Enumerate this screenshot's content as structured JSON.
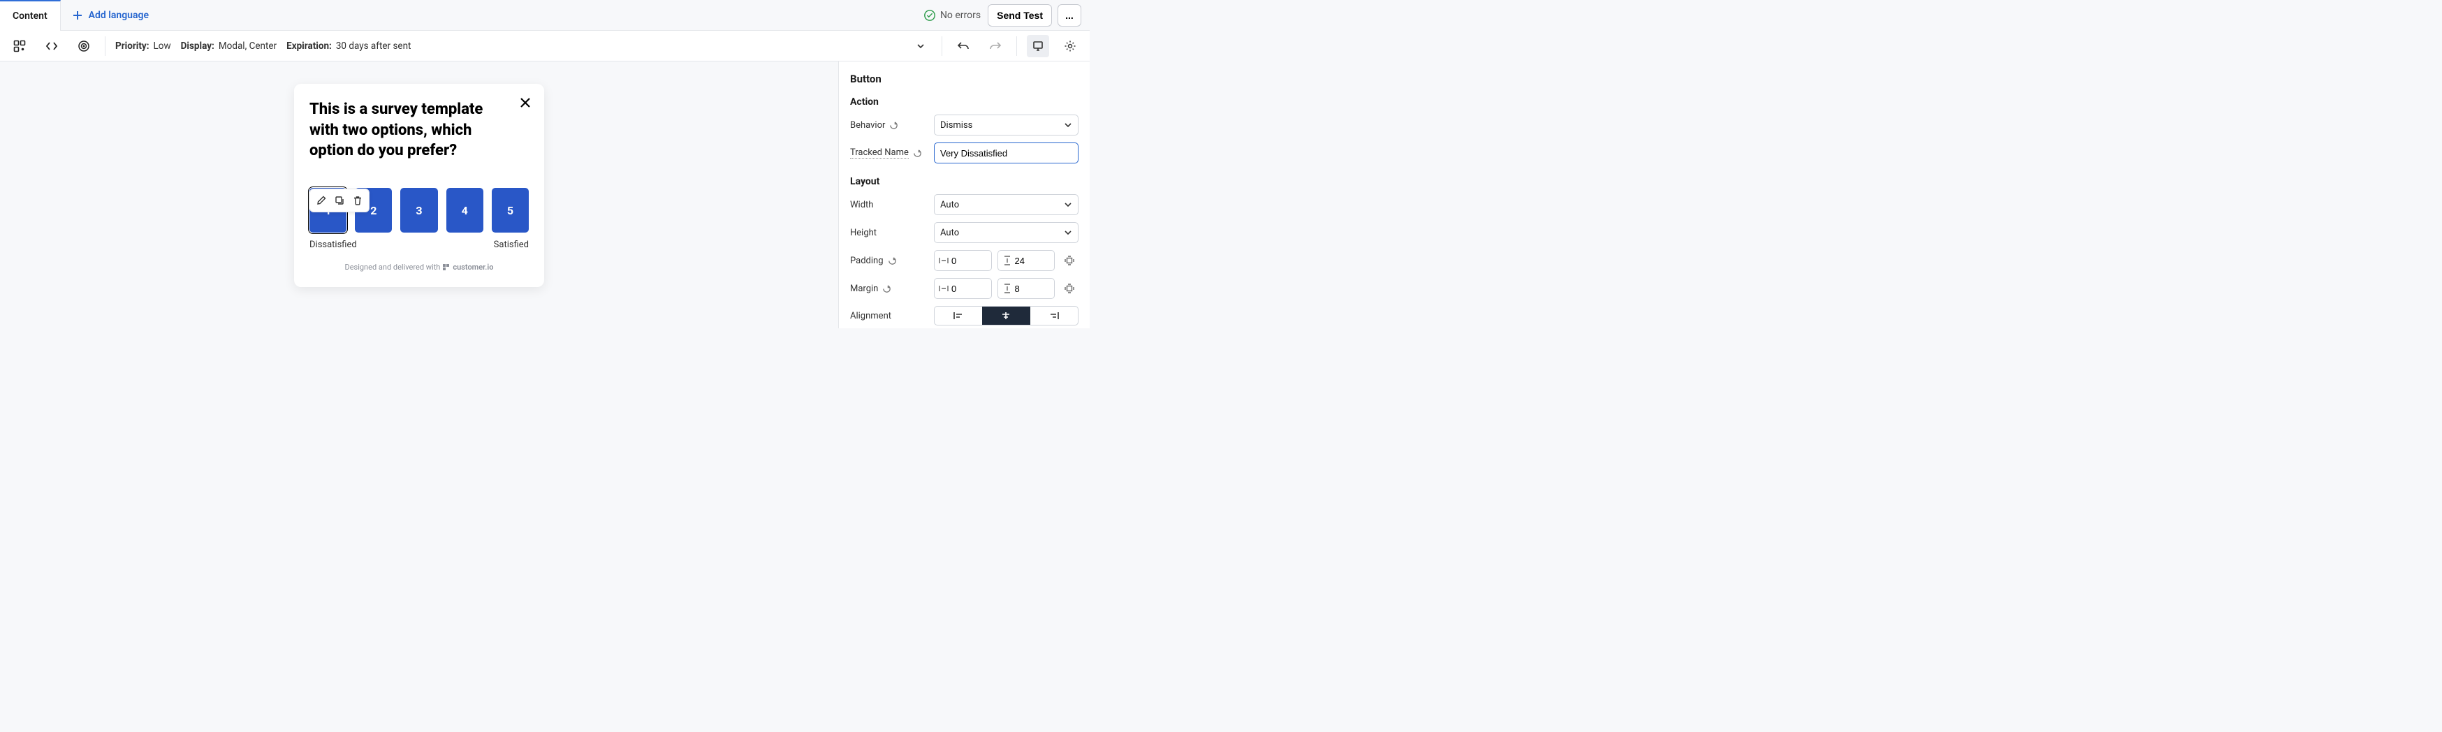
{
  "tabs": {
    "active": "Content",
    "add_language": "Add language"
  },
  "status": {
    "no_errors": "No errors",
    "send_test": "Send Test",
    "more": "..."
  },
  "toolbar": {
    "priority": {
      "label": "Priority:",
      "value": "Low"
    },
    "display": {
      "label": "Display:",
      "value": "Modal, Center"
    },
    "expiration": {
      "label": "Expiration:",
      "value": "30 days after sent"
    }
  },
  "survey": {
    "title": "This is a survey template with two options, which option do you prefer?",
    "options": [
      "1",
      "2",
      "3",
      "4",
      "5"
    ],
    "label_left": "Dissatisfied",
    "label_right": "Satisfied",
    "footer": "Designed and delivered with",
    "brand": "customer.io"
  },
  "panel": {
    "heading": "Button",
    "action": {
      "section": "Action",
      "behavior_label": "Behavior",
      "behavior_value": "Dismiss",
      "tracked_label": "Tracked Name",
      "tracked_value": "Very Dissatisfied"
    },
    "layout": {
      "section": "Layout",
      "width_label": "Width",
      "width_value": "Auto",
      "height_label": "Height",
      "height_value": "Auto",
      "padding_label": "Padding",
      "padding_h": "0",
      "padding_v": "24",
      "margin_label": "Margin",
      "margin_h": "0",
      "margin_v": "8",
      "alignment_label": "Alignment"
    }
  }
}
